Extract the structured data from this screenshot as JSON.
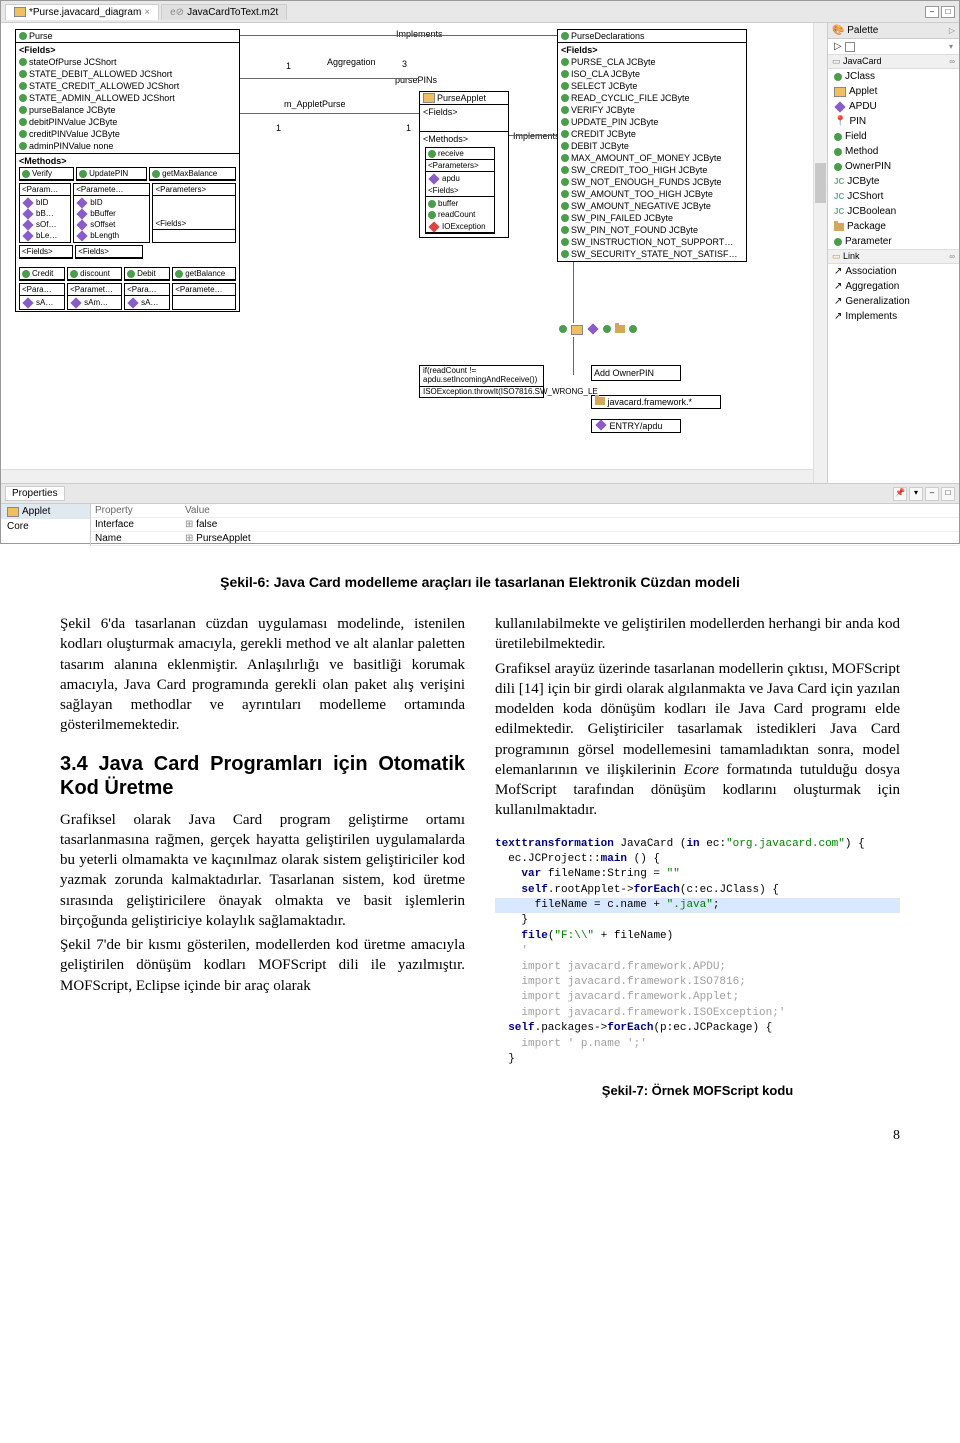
{
  "ide": {
    "tabs": [
      {
        "label": "*Purse.javacard_diagram",
        "icon": "diagram-icon",
        "active": true
      },
      {
        "label": "JavaCardToText.m2t",
        "icon": "m2t-icon",
        "active": false
      }
    ],
    "canvas": {
      "purse_box": {
        "title": "Purse",
        "section1_label": "<Fields>",
        "fields": [
          "stateOfPurse JCShort",
          "STATE_DEBIT_ALLOWED JCShort",
          "STATE_CREDIT_ALLOWED JCShort",
          "STATE_ADMIN_ALLOWED JCShort",
          "purseBalance JCByte",
          "debitPINValue JCByte",
          "creditPINValue JCByte",
          "adminPINValue none"
        ],
        "section2_label": "<Methods>",
        "methods": [
          "Verify",
          "UpdatePIN",
          "getMaxBalance"
        ],
        "subboxes": {
          "p1": {
            "h": "<Param…",
            "rows": [
              "bID",
              "bB…",
              "sOf…",
              "bLe…"
            ]
          },
          "p2": {
            "h": "<Paramete…",
            "rows": [
              "bID",
              "bBuffer",
              "sOffset",
              "bLength"
            ]
          },
          "p3": {
            "h": "<Parameters>"
          },
          "f1": {
            "h": "<Fields>"
          },
          "f2": {
            "h": "<Fields>"
          }
        },
        "methods2": [
          "Credit",
          "discount",
          "Debit",
          "getBalance"
        ],
        "sub2": {
          "a": {
            "h": "<Para…",
            "rows": [
              "sA…"
            ]
          },
          "b": {
            "h": "<Paramet…",
            "rows": [
              "sAm…"
            ]
          },
          "c": {
            "h": "<Para…",
            "rows": [
              "sA…"
            ]
          },
          "d": {
            "h": "<Paramete…"
          }
        }
      },
      "decl_box": {
        "title": "PurseDeclarations",
        "section1_label": "<Fields>",
        "fields": [
          "PURSE_CLA JCByte",
          "ISO_CLA JCByte",
          "SELECT JCByte",
          "READ_CYCLIC_FILE JCByte",
          "VERIFY JCByte",
          "UPDATE_PIN JCByte",
          "CREDIT JCByte",
          "DEBIT JCByte",
          "MAX_AMOUNT_OF_MONEY JCByte",
          "SW_CREDIT_TOO_HIGH JCByte",
          "SW_NOT_ENOUGH_FUNDS JCByte",
          "SW_AMOUNT_TOO_HIGH JCByte",
          "SW_AMOUNT_NEGATIVE JCByte",
          "SW_PIN_FAILED JCByte",
          "SW_PIN_NOT_FOUND JCByte",
          "SW_INSTRUCTION_NOT_SUPPORT…",
          "SW_SECURITY_STATE_NOT_SATISF…"
        ]
      },
      "applet_box": {
        "title": "PurseApplet",
        "s1": "<Fields>",
        "s2": "<Methods>"
      },
      "receive_box": {
        "title": "receive",
        "s_params": "<Parameters>",
        "param": "apdu",
        "s_fields": "<Fields>",
        "fields": [
          "buffer",
          "readCount"
        ],
        "exc": "IOException"
      },
      "if_box": {
        "cond": "if(readCount != apdu.setIncomingAndReceive())",
        "thr": "ISOException.throwIt(ISO7816.SW_WRONG_LE"
      },
      "conn": {
        "implements": "Implements",
        "aggregation": "Aggregation",
        "pursePINs": "pursePINs",
        "m_AppletPurse": "m_AppletPurse",
        "implements2": "Implements",
        "n1": "1",
        "n1b": "1",
        "n3": "3",
        "n1c": "1"
      },
      "pkg_labels": {
        "addOwnerPin": "Add OwnerPIN",
        "framework": "javacard.framework.*",
        "entry": "ENTRY/apdu"
      }
    },
    "palette": {
      "title": "Palette",
      "sections": {
        "javacard": "JavaCard",
        "link": "Link"
      },
      "jc_items": [
        {
          "icon": "dot-green",
          "label": "JClass"
        },
        {
          "icon": "applet-icon",
          "label": "Applet"
        },
        {
          "icon": "diamond-p",
          "label": "APDU"
        },
        {
          "icon": "pin-icon",
          "label": "PIN"
        },
        {
          "icon": "dot-green",
          "label": "Field"
        },
        {
          "icon": "dot-green",
          "label": "Method"
        },
        {
          "icon": "dot-green",
          "label": "OwnerPIN"
        },
        {
          "icon": "jc-icon",
          "label": "JCByte"
        },
        {
          "icon": "jc-icon",
          "label": "JCShort"
        },
        {
          "icon": "jc-icon",
          "label": "JCBoolean"
        },
        {
          "icon": "pkg-icon",
          "label": "Package"
        },
        {
          "icon": "dot-green",
          "label": "Parameter"
        }
      ],
      "link_items": [
        {
          "label": "Association"
        },
        {
          "label": "Aggregation"
        },
        {
          "label": "Generalization"
        },
        {
          "label": "Implements"
        }
      ]
    },
    "properties": {
      "tab": "Properties",
      "left": [
        {
          "label": "Applet",
          "selected": true,
          "icon": "applet-icon"
        },
        {
          "label": "Core",
          "selected": false
        }
      ],
      "hdr_prop": "Property",
      "hdr_val": "Value",
      "rows": [
        {
          "prop": "Interface",
          "val": "false"
        },
        {
          "prop": "Name",
          "val": "PurseApplet"
        }
      ]
    }
  },
  "article": {
    "fig6_caption": "Şekil-6: Java Card modelleme araçları ile tasarlanan Elektronik Cüzdan modeli",
    "col1": {
      "p1": "Şekil 6'da tasarlanan cüzdan uygulaması modelinde, istenilen kodları oluşturmak amacıyla, gerekli method ve alt alanlar paletten tasarım alanına eklenmiştir. Anlaşılırlığı ve basitliği korumak amacıyla, Java Card programında gerekli olan paket alış verişini sağlayan methodlar ve ayrıntıları modelleme ortamında gösterilmemektedir.",
      "h34": "3.4 Java Card Programları için Otomatik Kod Üretme",
      "p2": "Grafiksel olarak Java Card program geliştirme ortamı tasarlanmasına rağmen, gerçek hayatta geliştirilen uygulamalarda bu yeterli olmamakta ve kaçınılmaz olarak sistem geliştiriciler kod yazmak zorunda kalmaktadırlar. Tasarlanan sistem, kod üretme sırasında geliştiricilere önayak olmakta ve basit işlemlerin birçoğunda geliştiriciye kolaylık sağlamaktadır.",
      "p3": "Şekil 7'de bir kısmı gösterilen, modellerden kod üretme amacıyla geliştirilen dönüşüm kodları MOFScript dili ile yazılmıştır. MOFScript, Eclipse içinde bir araç olarak"
    },
    "col2": {
      "p1": "kullanılabilmekte ve geliştirilen modellerden herhangi bir anda kod üretilebilmektedir.",
      "p2_a": "Grafiksel arayüz üzerinde tasarlanan modellerin çıktısı, MOFScript dili [14] için bir girdi olarak algılanmakta ve Java Card için yazılan modelden koda dönüşüm kodları ile Java Card programı elde edilmektedir. Geliştiriciler tasarlamak istedikleri Java Card programının görsel modellemesini tamamladıktan sonra, model elemanlarının ve ilişkilerinin ",
      "p2_ecore": "Ecore",
      "p2_b": " formatında tutulduğu dosya MofScript tarafından dönüşüm kodlarını oluşturmak için kullanılmaktadır.",
      "code": {
        "l1a": "texttransformation",
        "l1b": " JavaCard (",
        "l1c": "in",
        "l1d": " ec:",
        "l1e": "\"org.javacard.com\"",
        "l1f": ") {",
        "l2a": "  ec.JCProject::",
        "l2b": "main",
        "l2c": " () {",
        "l3a": "    var",
        "l3b": " fileName:String = ",
        "l3c": "\"\"",
        "l4a": "    self",
        "l4b": ".rootApplet->",
        "l4c": "forEach",
        "l4d": "(c:ec.JClass) {",
        "l5a": "      fileName = c.name + ",
        "l5b": "\".java\"",
        "l5c": ";",
        "l6": "    }",
        "l7a": "    file",
        "l7b": "(",
        "l7c": "\"F:\\\\\"",
        "l7d": " + fileName)",
        "l8": "    '",
        "l9a": "    import javacard.framework.APDU;",
        "l10a": "    import javacard.framework.ISO7816;",
        "l11a": "    import javacard.framework.Applet;",
        "l12a": "    import javacard.framework.ISOException;'",
        "l13a": "  self",
        "l13b": ".packages->",
        "l13c": "forEach",
        "l13d": "(p:ec.JCPackage) {",
        "l14": "",
        "l15a": "    import ",
        "l15b": "' p.name ';'",
        "l16": "  }"
      },
      "fig7_caption": "Şekil-7: Örnek MOFScript kodu"
    },
    "pagenum": "8"
  }
}
